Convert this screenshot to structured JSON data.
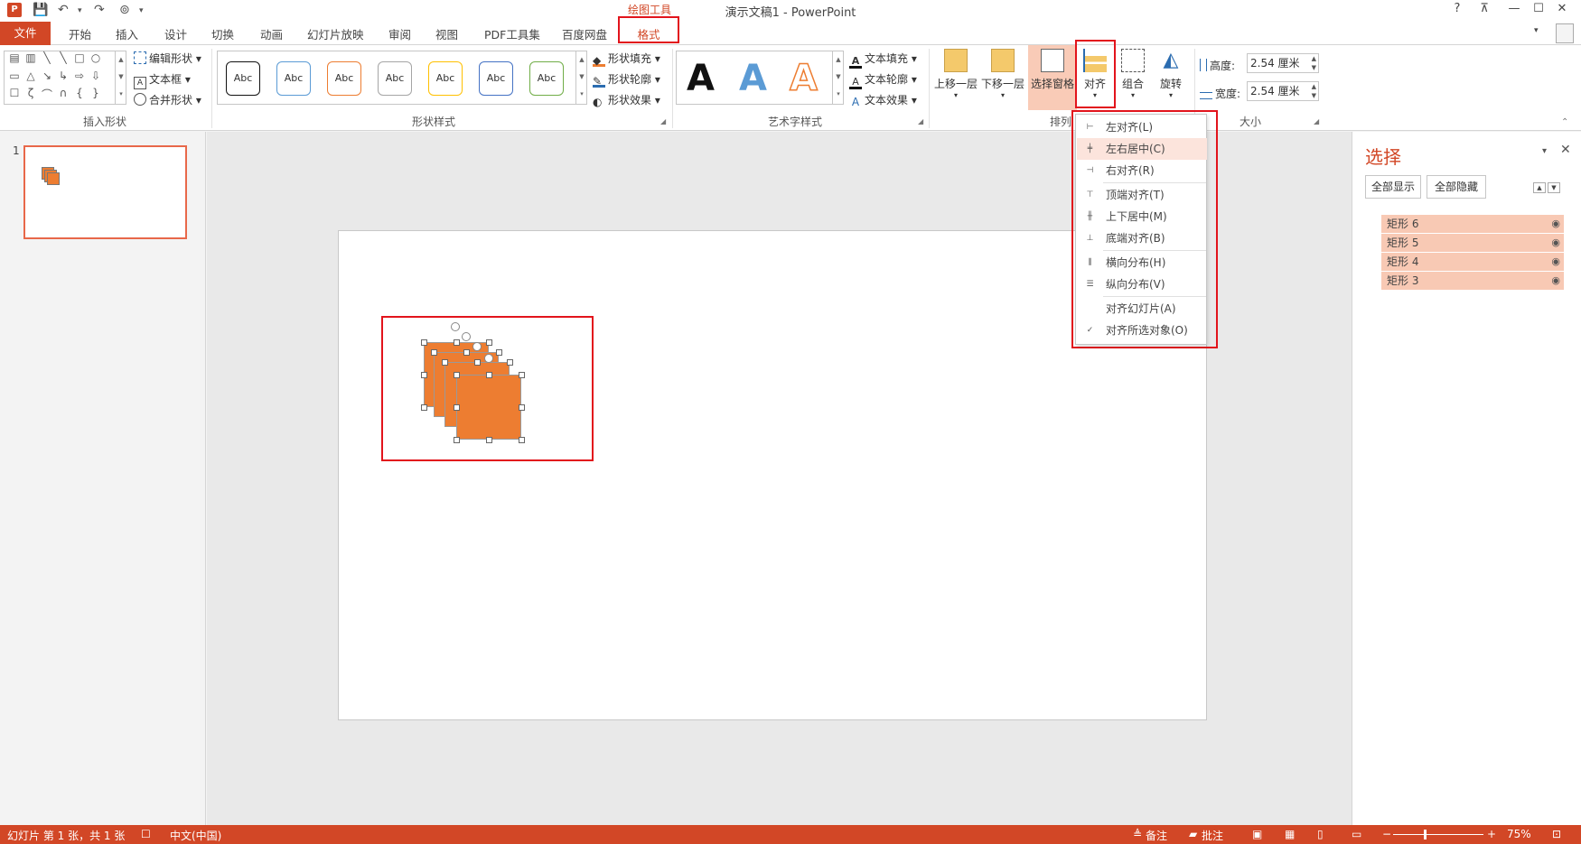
{
  "app": {
    "title": "演示文稿1 - PowerPoint",
    "context_tool": "绘图工具",
    "app_icon_letter": "P",
    "window_buttons": [
      "?",
      "⊼",
      "—",
      "☐",
      "✕"
    ]
  },
  "tabs": {
    "file": "文件",
    "items": [
      "开始",
      "插入",
      "设计",
      "切换",
      "动画",
      "幻灯片放映",
      "审阅",
      "视图",
      "PDF工具集",
      "百度网盘"
    ],
    "active": "格式"
  },
  "ribbon": {
    "insert_shapes": {
      "label": "插入形状",
      "edit_shape": "编辑形状",
      "text_box": "文本框",
      "merge_shapes": "合并形状",
      "shape_glyphs": [
        "▤",
        "▥",
        "╲",
        "╲",
        "□",
        "○",
        "▭",
        "△",
        "↘",
        "↳",
        "⇨",
        "⇩",
        "☐",
        "ζ",
        "⌒",
        "∩",
        "{",
        "}"
      ]
    },
    "shape_styles": {
      "label": "形状样式",
      "preset_text": "Abc",
      "preset_colors": [
        "#111111",
        "#5b9bd5",
        "#ed7d31",
        "#a5a5a5",
        "#ffc000",
        "#4472c4",
        "#70ad47"
      ],
      "fill": "形状填充",
      "outline": "形状轮廓",
      "effects": "形状效果"
    },
    "wordart": {
      "label": "艺术字样式",
      "letters": [
        "A",
        "A",
        "A"
      ],
      "text_fill": "文本填充",
      "text_outline": "文本轮廓",
      "text_effects": "文本效果"
    },
    "arrange": {
      "label": "排列",
      "bring_forward": "上移一层",
      "send_backward": "下移一层",
      "selection_pane": "选择窗格",
      "align": "对齐",
      "group": "组合",
      "rotate": "旋转"
    },
    "size": {
      "label": "大小",
      "height_label": "高度:",
      "height_value": "2.54 厘米",
      "width_label": "宽度:",
      "width_value": "2.54 厘米"
    }
  },
  "thumbnails": {
    "slide_number": "1"
  },
  "align_menu": {
    "items": [
      {
        "label": "左对齐(L)",
        "icon": "align-left-icon",
        "glyph": "⊢"
      },
      {
        "label": "左右居中(C)",
        "icon": "align-center-icon",
        "glyph": "╪",
        "highlighted": true
      },
      {
        "label": "右对齐(R)",
        "icon": "align-right-icon",
        "glyph": "⊣"
      },
      {
        "label": "顶端对齐(T)",
        "icon": "align-top-icon",
        "glyph": "⊤"
      },
      {
        "label": "上下居中(M)",
        "icon": "align-middle-icon",
        "glyph": "╫"
      },
      {
        "label": "底端对齐(B)",
        "icon": "align-bottom-icon",
        "glyph": "⊥"
      },
      {
        "label": "横向分布(H)",
        "icon": "distribute-horizontal-icon",
        "glyph": "⫼"
      },
      {
        "label": "纵向分布(V)",
        "icon": "distribute-vertical-icon",
        "glyph": "☰"
      },
      {
        "label": "对齐幻灯片(A)",
        "icon": "",
        "glyph": ""
      },
      {
        "label": "对齐所选对象(O)",
        "icon": "checkmark-icon",
        "glyph": "✓"
      }
    ]
  },
  "selection_pane": {
    "title": "选择",
    "show_all": "全部显示",
    "hide_all": "全部隐藏",
    "layers": [
      "矩形 6",
      "矩形 5",
      "矩形 4",
      "矩形 3"
    ]
  },
  "statusbar": {
    "slide_info": "幻灯片 第 1 张，共 1 张",
    "language": "中文(中国)",
    "notes": "备注",
    "comments": "批注",
    "zoom": "75%"
  },
  "colors": {
    "accent": "#d24726",
    "shape_fill": "#ed7d31",
    "highlight_outline": "#e2141c",
    "layer_bg": "#f8c9b4"
  }
}
